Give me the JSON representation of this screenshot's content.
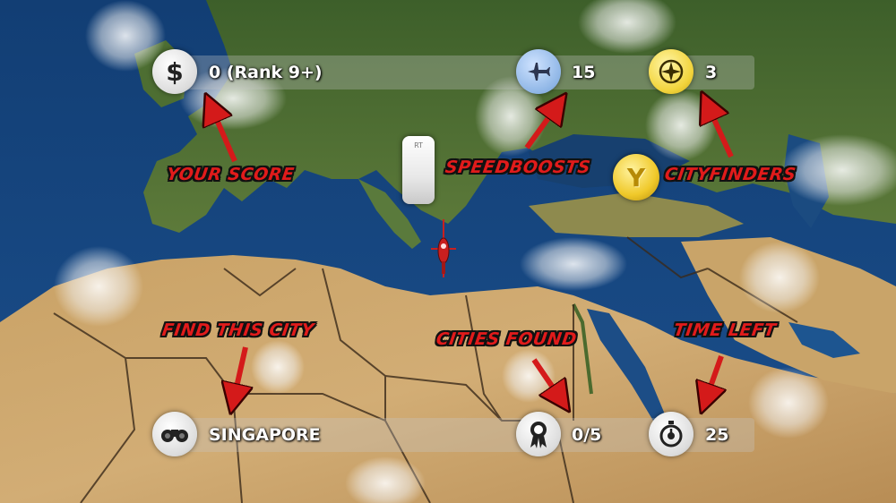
{
  "hud": {
    "score": {
      "icon": "dollar-icon",
      "value": "0 (Rank 9+)"
    },
    "speedboosts": {
      "icon": "jet-icon",
      "value": "15"
    },
    "cityfinders": {
      "icon": "compass-icon",
      "value": "3"
    },
    "target_city": {
      "icon": "binoculars-icon",
      "value": "SINGAPORE"
    },
    "cities_found": {
      "icon": "ribbon-icon",
      "value": "0/5"
    },
    "time_left": {
      "icon": "stopwatch-icon",
      "value": "25"
    }
  },
  "callouts": {
    "score": "YOUR SCORE",
    "speedboosts": "SPEEDBOOSTS",
    "cityfinders": "CITYFINDERS",
    "find_city": "FIND THIS CITY",
    "cities_found": "CITIES FOUND",
    "time_left": "TIME LEFT"
  },
  "buttons": {
    "speedboost_trigger": "RT",
    "cityfinder_trigger": "Y"
  },
  "colors": {
    "callout": "#e11b1b",
    "arrow": "#d41a1a",
    "sea": "#1f4f86",
    "desert": "#c9a06a",
    "land": "#4f6f33"
  }
}
